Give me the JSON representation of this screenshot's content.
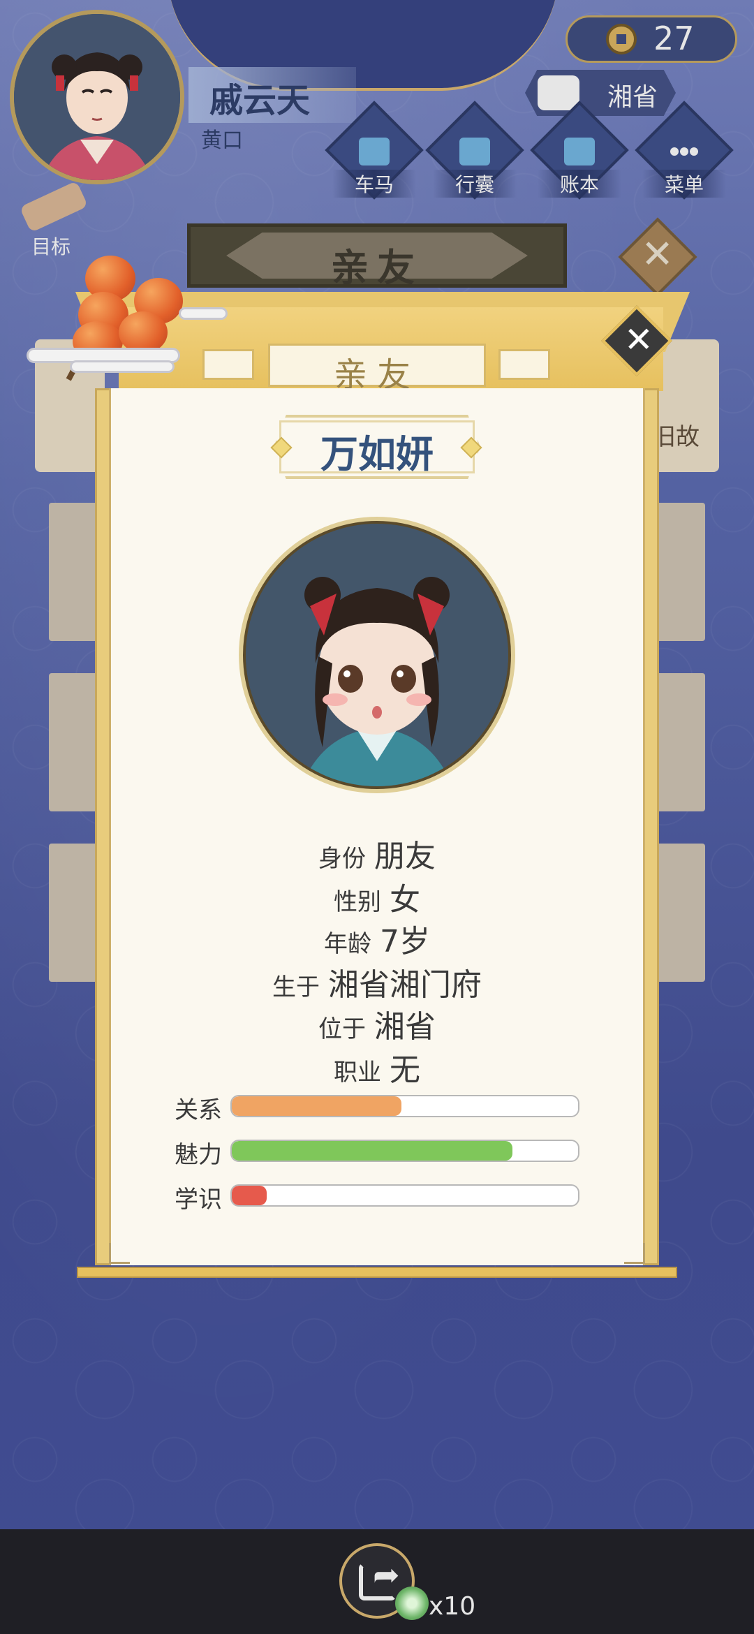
{
  "header": {
    "player_name": "戚云天",
    "player_status": "黄口",
    "coins": "27",
    "location": "湘省",
    "goal_label": "目标",
    "nav": [
      {
        "label": "车马",
        "icon": "carriage-icon"
      },
      {
        "label": "行囊",
        "icon": "bag-icon"
      },
      {
        "label": "账本",
        "icon": "ledger-icon"
      },
      {
        "label": "菜单",
        "icon": "menu-icon"
      }
    ]
  },
  "background": {
    "banner_title": "亲友",
    "side_scroll_text": "旧故"
  },
  "dialog": {
    "tab_title": "亲友",
    "person_name": "万如妍",
    "info": [
      {
        "key": "身份",
        "value": "朋友"
      },
      {
        "key": "性别",
        "value": "女"
      },
      {
        "key": "年龄",
        "value": "7岁"
      },
      {
        "key": "生于",
        "value": "湘省湘门府"
      },
      {
        "key": "位于",
        "value": "湘省"
      },
      {
        "key": "职业",
        "value": "无"
      }
    ],
    "stats": [
      {
        "label": "关系",
        "value": 0.49,
        "color": "#f0a463"
      },
      {
        "label": "魅力",
        "value": 0.81,
        "color": "#7fc75a"
      },
      {
        "label": "学识",
        "value": 0.1,
        "color": "#e65a4c"
      }
    ]
  },
  "bottom": {
    "multiplier": "x10"
  }
}
